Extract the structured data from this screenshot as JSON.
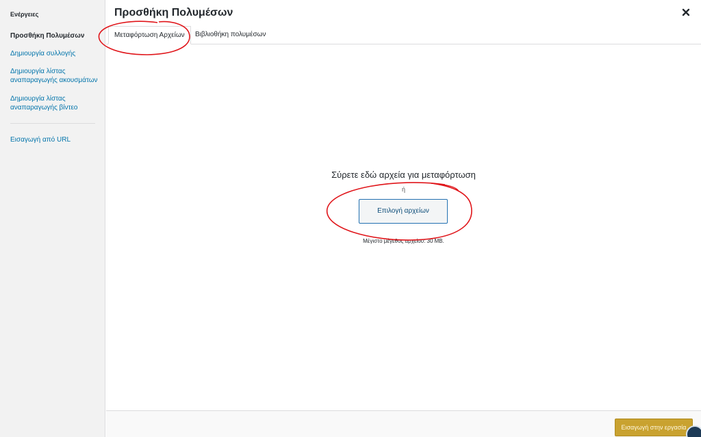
{
  "sidebar": {
    "heading": "Ενέργειες",
    "items": [
      {
        "label": "Προσθήκη Πολυμέσων"
      },
      {
        "label": "Δημιουργία συλλογής"
      },
      {
        "label": "Δημιουργία λίστας αναπαραγωγής ακουσμάτων"
      },
      {
        "label": "Δημιουργία λίστας αναπαραγωγής βίντεο"
      },
      {
        "label": "Εισαγωγή από URL"
      }
    ]
  },
  "header": {
    "title": "Προσθήκη Πολυμέσων",
    "close_icon": "close-icon"
  },
  "tabs": [
    {
      "label": "Μεταφόρτωση Αρχείων",
      "active": true
    },
    {
      "label": "Βιβλιοθήκη πολυμέσων",
      "active": false
    }
  ],
  "uploader": {
    "instructions": "Σύρετε εδώ αρχεία για μεταφόρτωση",
    "or": "ή",
    "select_button": "Επιλογή αρχείων",
    "max_size": "Μέγιστο μέγεθος αρχείου: 30 MB."
  },
  "footer": {
    "insert_button": "Εισαγωγή στην εργασία"
  },
  "colors": {
    "link": "#0073aa",
    "annotation": "#e0151a",
    "insert_button": "#c9a230"
  }
}
